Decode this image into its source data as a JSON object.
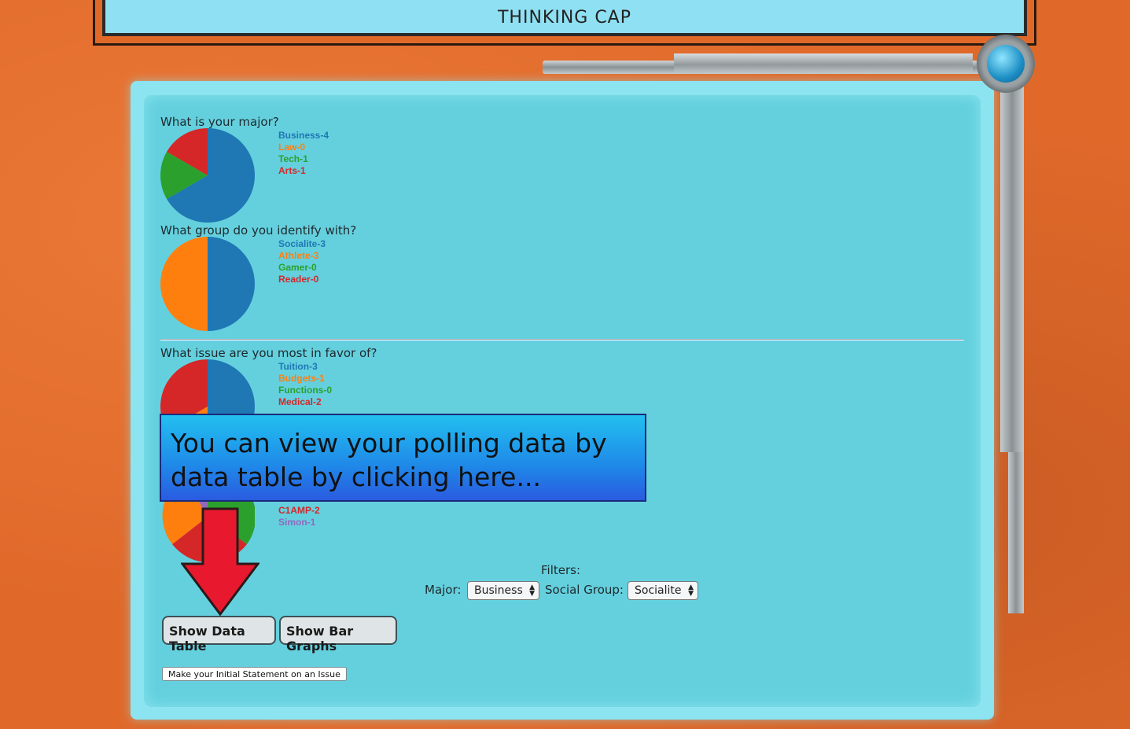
{
  "header": {
    "title": "THINKING CAP"
  },
  "questions": [
    {
      "title": "What is your major?",
      "legend": [
        {
          "label": "Business-4",
          "color": "#1f77b4"
        },
        {
          "label": "Law-0",
          "color": "#ff7f0e"
        },
        {
          "label": "Tech-1",
          "color": "#2ca02c"
        },
        {
          "label": "Arts-1",
          "color": "#d62728"
        }
      ]
    },
    {
      "title": "What group do you identify with?",
      "legend": [
        {
          "label": "Socialite-3",
          "color": "#1f77b4"
        },
        {
          "label": "Athlete-3",
          "color": "#ff7f0e"
        },
        {
          "label": "Gamer-0",
          "color": "#2ca02c"
        },
        {
          "label": "Reader-0",
          "color": "#d62728"
        }
      ]
    },
    {
      "title": "What issue are you most in favor of?",
      "legend": [
        {
          "label": "Tuition-3",
          "color": "#1f77b4"
        },
        {
          "label": "Budgets-1",
          "color": "#ff7f0e"
        },
        {
          "label": "Functions-0",
          "color": "#2ca02c"
        },
        {
          "label": "Medical-2",
          "color": "#d62728"
        }
      ]
    },
    {
      "legend": [
        {
          "label": "C1AMP-2",
          "color": "#d62728"
        },
        {
          "label": "Simon-1",
          "color": "#9467bd"
        }
      ]
    }
  ],
  "callout": {
    "text": "You can view your polling data by data table by clicking here..."
  },
  "filters": {
    "label": "Filters:",
    "major_label": "Major:",
    "major_value": "Business",
    "group_label": "Social Group:",
    "group_value": "Socialite"
  },
  "buttons": {
    "data_table": "Show Data Table",
    "bar_graphs": "Show Bar Graphs",
    "initial_statement": "Make your Initial Statement on an Issue"
  },
  "chart_data": [
    {
      "type": "pie",
      "title": "What is your major?",
      "categories": [
        "Business",
        "Law",
        "Tech",
        "Arts"
      ],
      "values": [
        4,
        0,
        1,
        1
      ],
      "colors": [
        "#1f77b4",
        "#ff7f0e",
        "#2ca02c",
        "#d62728"
      ]
    },
    {
      "type": "pie",
      "title": "What group do you identify with?",
      "categories": [
        "Socialite",
        "Athlete",
        "Gamer",
        "Reader"
      ],
      "values": [
        3,
        3,
        0,
        0
      ],
      "colors": [
        "#1f77b4",
        "#ff7f0e",
        "#2ca02c",
        "#d62728"
      ]
    },
    {
      "type": "pie",
      "title": "What issue are you most in favor of?",
      "categories": [
        "Tuition",
        "Budgets",
        "Functions",
        "Medical"
      ],
      "values": [
        3,
        1,
        0,
        2
      ],
      "colors": [
        "#1f77b4",
        "#ff7f0e",
        "#2ca02c",
        "#d62728"
      ]
    }
  ]
}
